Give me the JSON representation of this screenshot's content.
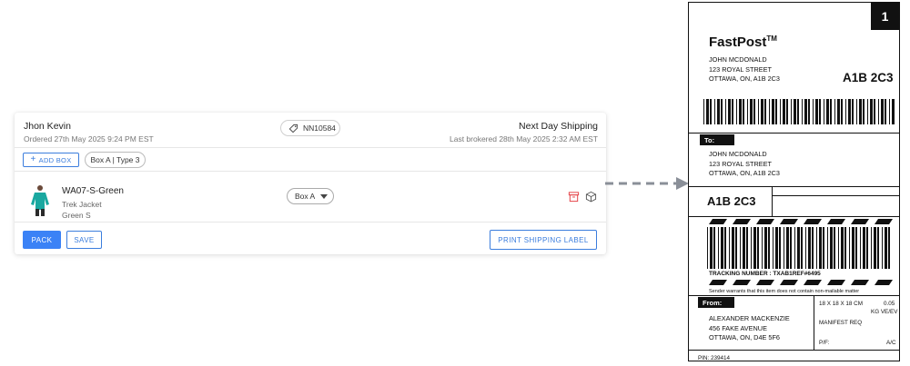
{
  "order": {
    "customer_name": "Jhon Kevin",
    "ordered_at": "Ordered 27th May 2025 9:24 PM EST",
    "order_number": "NN10584",
    "shipping_method": "Next Day Shipping",
    "last_brokered": "Last brokered 28th May 2025 2:32 AM EST"
  },
  "boxes": {
    "add_label": "ADD BOX",
    "box_chip": "Box A | Type 3"
  },
  "item": {
    "sku": "WA07-S-Green",
    "product_name": "Trek Jacket",
    "variant": "Green S",
    "box_select_value": "Box A"
  },
  "actions": {
    "pack": "PACK",
    "save": "SAVE",
    "print_label": "PRINT SHIPPING LABEL"
  },
  "label": {
    "number": "1",
    "brand": "FastPost",
    "trademark": "TM",
    "ship_to_header": [
      "JOHN MCDONALD",
      "123 ROYAL STREET",
      "OTTAWA, ON, A1B 2C3"
    ],
    "postal_code": "A1B 2C3",
    "to_tag": "To:",
    "to_address": [
      "JOHN MCDONALD",
      "123 ROYAL STREET",
      "OTTAWA, ON, A1B 2C3"
    ],
    "postal_code_2": "A1B 2C3",
    "tracking_number": "TRACKING NUMBER :   TXAB1REF#6495",
    "warranty_note": "Sender warrants that this item does not contain non-mailable matter",
    "from_tag": "From:",
    "from_address": [
      "ALEXANDER MACKENZIE",
      "456 FAKE AVENUE",
      "OTTAWA, ON, D4E 5F6"
    ],
    "dimensions": "18 X 18 X 18 CM",
    "weight": "0.05",
    "weight_unit": "KG VE/EV",
    "manifest": "MANIFEST REQ",
    "pf": "P/F:",
    "ac": "A/C",
    "pin": "PIN: 239414"
  },
  "colors": {
    "accent": "#3b82f6",
    "accent_outline": "#3b7ddd",
    "icon_red": "#e5484d"
  }
}
